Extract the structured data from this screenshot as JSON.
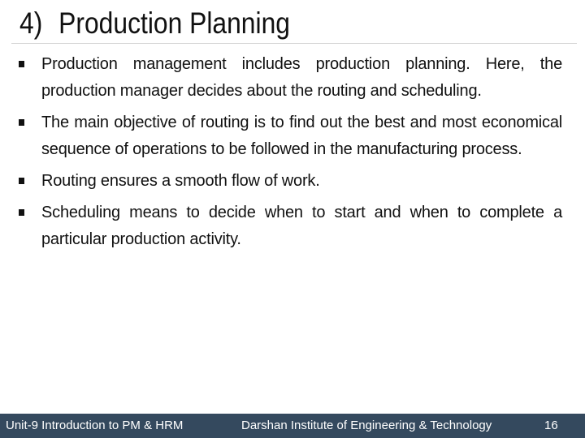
{
  "slide": {
    "title_number": "4)",
    "title_text": "Production Planning",
    "bullets": [
      "Production management includes production planning. Here, the production manager decides about the routing and scheduling.",
      "The main objective of routing is to find out the best and most economical sequence of operations to be followed in the manufacturing process.",
      "Routing ensures a smooth flow of work.",
      "Scheduling means to decide when to start and when to complete a particular production activity."
    ],
    "bullet_icon": "square-bullet-icon"
  },
  "footer": {
    "unit": "Unit-9 Introduction to PM & HRM",
    "institute": "Darshan Institute of Engineering & Technology",
    "page_number": "16",
    "background_color": "#34495e"
  }
}
